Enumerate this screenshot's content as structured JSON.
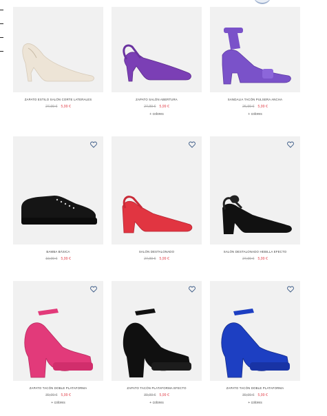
{
  "products": [
    {
      "name": "ZAPATO ESTILO SALÓN CORTE LATERALES",
      "old_price": "27,99 €",
      "price": "5,99 €",
      "more": "",
      "shoe_icon": "beige-pump-icon",
      "color": "#ede4d6"
    },
    {
      "name": "ZAPATO SALÓN ABERTURA",
      "old_price": "27,99 €",
      "price": "5,99 €",
      "more": "+ colores",
      "shoe_icon": "purple-slingback-icon",
      "color": "#7b3fb5"
    },
    {
      "name": "SANDALIA TACÓN PULSERA ANCHA",
      "old_price": "26,99 €",
      "price": "5,99 €",
      "more": "+ colores",
      "shoe_icon": "purple-sandal-icon",
      "color": "#7a52c9"
    },
    {
      "name": "BAMBA BÁSICA",
      "old_price": "19,99 €",
      "price": "5,99 €",
      "more": "",
      "shoe_icon": "black-sneaker-icon",
      "color": "#141414"
    },
    {
      "name": "SALÓN DESTALONADO",
      "old_price": "27,99 €",
      "price": "5,99 €",
      "more": "",
      "shoe_icon": "red-slingback-icon",
      "color": "#e13541"
    },
    {
      "name": "SALÓN DESTALONADO HEBILLA EFECTO",
      "old_price": "27,99 €",
      "price": "5,99 €",
      "more": "",
      "shoe_icon": "black-slingback-icon",
      "color": "#111111"
    },
    {
      "name": "ZAPATO TACÓN DOBLE PLATAFORMA",
      "old_price": "39,99 €",
      "price": "5,99 €",
      "more": "+ colores",
      "shoe_icon": "pink-platform-icon",
      "color": "#e23a7a"
    },
    {
      "name": "ZAPATO TACÓN PLATAFORMA EFECTO",
      "old_price": "39,99 €",
      "price": "5,99 €",
      "more": "+ colores",
      "shoe_icon": "black-platform-icon",
      "color": "#101010"
    },
    {
      "name": "ZAPATO TACÓN DOBLE PLATAFORMA",
      "old_price": "39,99 €",
      "price": "5,99 €",
      "more": "+ colores",
      "shoe_icon": "blue-platform-icon",
      "color": "#1d3fc2"
    }
  ],
  "colors": {
    "accent_price": "#e2454f",
    "old_price": "#a5a5a5",
    "tile_bg": "#f1f1f1",
    "favorite": "#3b5a86"
  },
  "icons": {
    "favorite": "heart-icon"
  }
}
